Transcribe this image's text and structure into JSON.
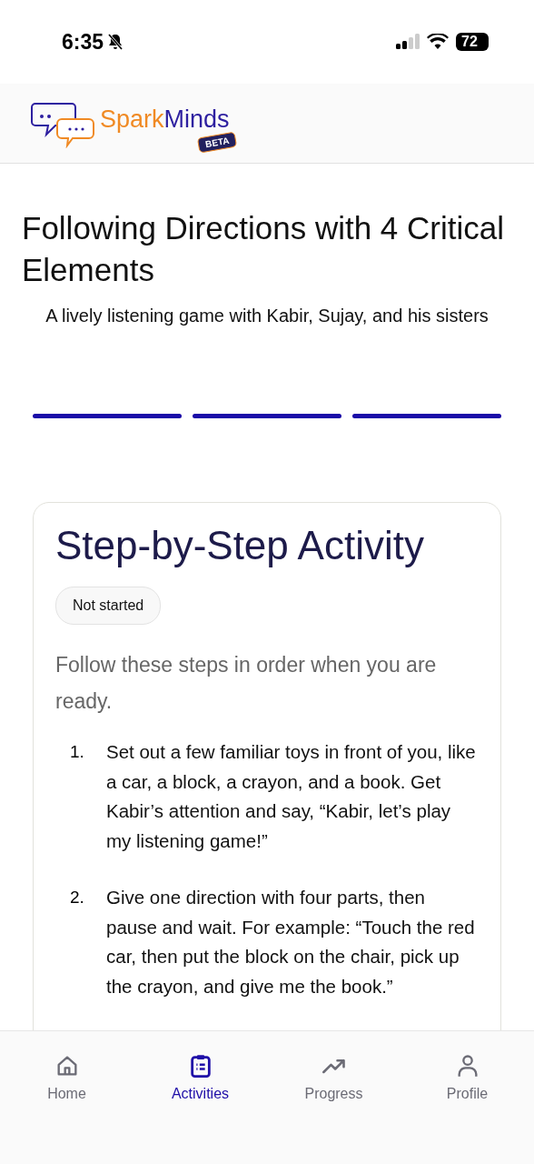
{
  "status_bar": {
    "time": "6:35",
    "battery": "72"
  },
  "header": {
    "brand_first": "Spark",
    "brand_second": "Minds",
    "badge": "BETA"
  },
  "activity": {
    "title": "Following Directions with 4 Critical Elements",
    "subtitle": "A lively listening game with Kabir, Sujay, and his sisters"
  },
  "progress_segments": [
    {
      "level": 1
    },
    {
      "level": 1
    },
    {
      "level": 1
    }
  ],
  "card": {
    "title": "Step-by-Step Activity",
    "status": "Not started",
    "intro": "Follow these steps in order when you are ready.",
    "steps": [
      {
        "number": "1.",
        "text": "Set out a few familiar toys in front of you, like a car, a block, a crayon, and a book. Get Kabir’s attention and say, “Kabir, let’s play my listening game!”"
      },
      {
        "number": "2.",
        "text": "Give one direction with four parts, then pause and wait. For example: “Touch the red car, then put the block on the chair, pick up the crayon, and give me the book.”"
      }
    ]
  },
  "nav": [
    {
      "label": "Home",
      "selected": false
    },
    {
      "label": "Activities",
      "selected": true
    },
    {
      "label": "Progress",
      "selected": false
    },
    {
      "label": "Profile",
      "selected": false
    }
  ]
}
